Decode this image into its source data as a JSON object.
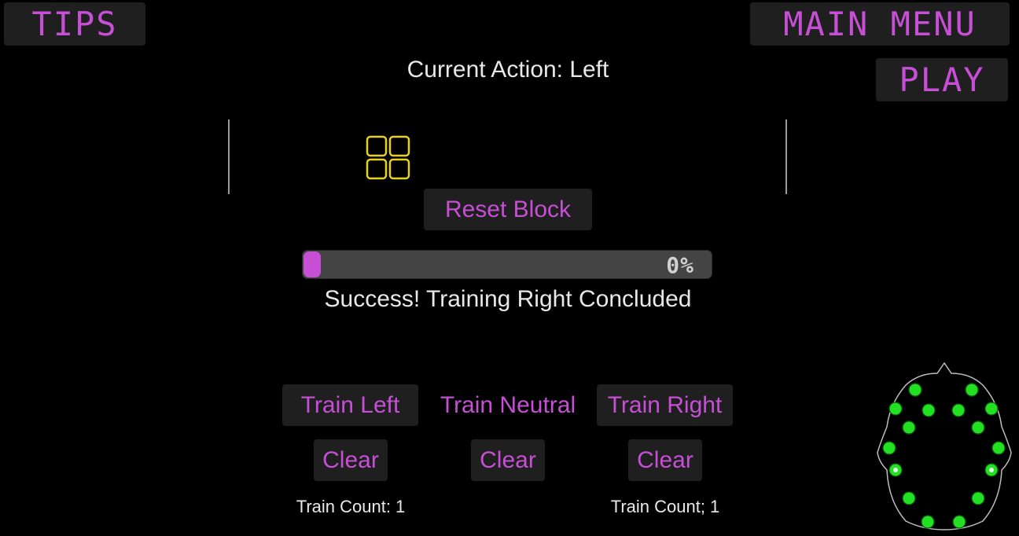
{
  "header": {
    "tips_label": "TIPS",
    "main_menu_label": "MAIN MENU",
    "play_label": "PLAY",
    "current_action": "Current Action: Left"
  },
  "training": {
    "reset_label": "Reset Block",
    "progress_text": "0%",
    "progress_fraction": 0.0,
    "status_text": "Success! Training Right Concluded",
    "train_left_label": "Train Left",
    "train_neutral_label": "Train Neutral",
    "train_right_label": "Train Right",
    "clear_left_label": "Clear",
    "clear_neutral_label": "Clear",
    "clear_right_label": "Clear",
    "count_left": "Train Count: 1",
    "count_right": "Train Count; 1"
  },
  "colors": {
    "accent": "#c64fd6",
    "block": "#e6d21a",
    "sensor_good": "#22e022",
    "background": "#000000"
  },
  "icons": {
    "block": "block-grid-icon",
    "headset": "eeg-headset-icon"
  }
}
